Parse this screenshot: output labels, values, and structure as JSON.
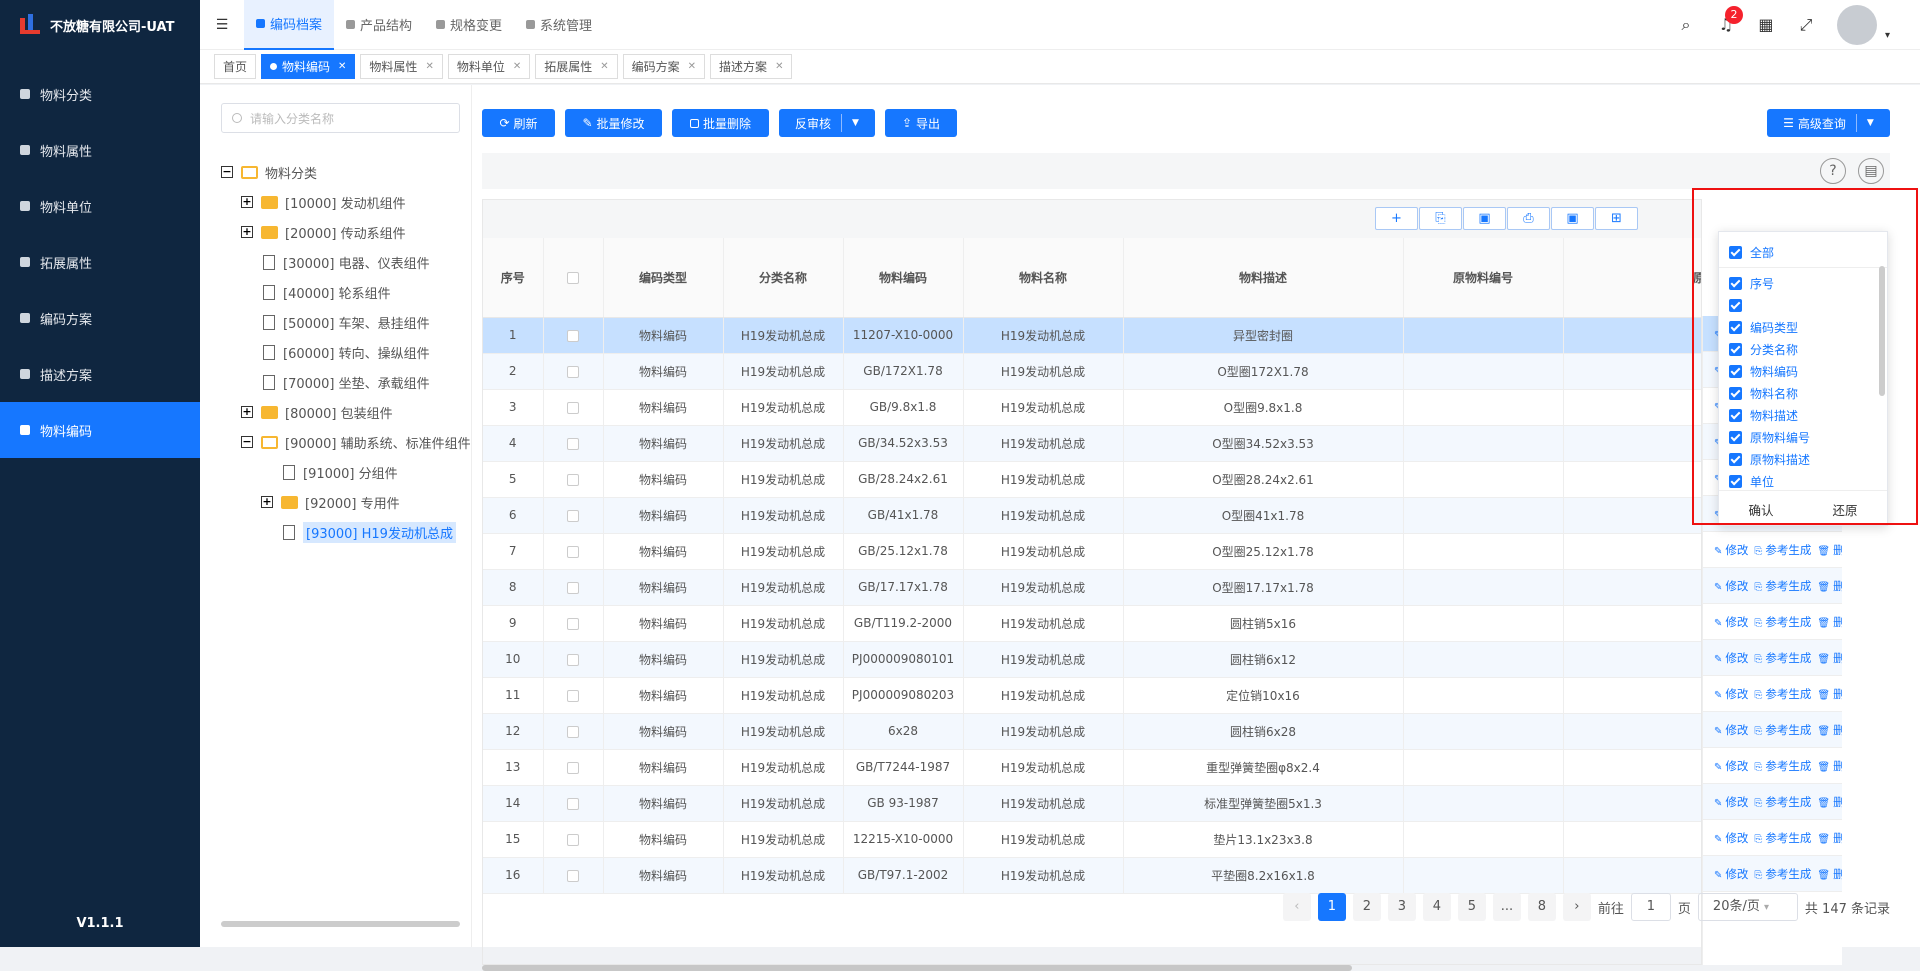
{
  "app": {
    "title": "不放糖有限公司-UAT",
    "version": "V1.1.1"
  },
  "sidebar": {
    "items": [
      {
        "label": "物料分类"
      },
      {
        "label": "物料属性"
      },
      {
        "label": "物料单位"
      },
      {
        "label": "拓展属性"
      },
      {
        "label": "编码方案"
      },
      {
        "label": "描述方案"
      },
      {
        "label": "物料编码"
      }
    ]
  },
  "header": {
    "tabs": [
      {
        "label": "编码档案"
      },
      {
        "label": "产品结构"
      },
      {
        "label": "规格变更"
      },
      {
        "label": "系统管理"
      }
    ],
    "notification_count": "2"
  },
  "tags": [
    {
      "label": "首页"
    },
    {
      "label": "物料编码"
    },
    {
      "label": "物料属性"
    },
    {
      "label": "物料单位"
    },
    {
      "label": "拓展属性"
    },
    {
      "label": "编码方案"
    },
    {
      "label": "描述方案"
    }
  ],
  "tree": {
    "search_placeholder": "请输入分类名称",
    "root": "物料分类",
    "nodes": [
      {
        "label": "[10000] 发动机组件"
      },
      {
        "label": "[20000] 传动系组件"
      },
      {
        "label": "[30000] 电器、仪表组件"
      },
      {
        "label": "[40000] 轮系组件"
      },
      {
        "label": "[50000] 车架、悬挂组件"
      },
      {
        "label": "[60000] 转向、操纵组件"
      },
      {
        "label": "[70000] 坐垫、承载组件"
      },
      {
        "label": "[80000] 包装组件"
      },
      {
        "label": "[90000] 辅助系统、标准件组件"
      },
      {
        "label": "[91000] 分组件"
      },
      {
        "label": "[92000] 专用件"
      },
      {
        "label": "[93000] H19发动机总成"
      }
    ]
  },
  "toolbar": {
    "refresh": "刷新",
    "batch_edit": "批量修改",
    "batch_delete": "批量删除",
    "unaudit": "反审核",
    "export": "导出",
    "advanced_search": "高级查询"
  },
  "table": {
    "columns": [
      "序号",
      "",
      "编码类型",
      "分类名称",
      "物料编码",
      "物料名称",
      "物料描述",
      "原物料编号",
      "原物料描述"
    ],
    "actions": {
      "edit": "修改",
      "ref": "参考生成",
      "del": "删除"
    },
    "rows": [
      {
        "no": "1",
        "type": "物料编码",
        "cat": "H19发动机总成",
        "code": "11207-X10-0000",
        "name": "H19发动机总成",
        "desc": "异型密封圈"
      },
      {
        "no": "2",
        "type": "物料编码",
        "cat": "H19发动机总成",
        "code": "GB/172X1.78",
        "name": "H19发动机总成",
        "desc": "O型圈172X1.78"
      },
      {
        "no": "3",
        "type": "物料编码",
        "cat": "H19发动机总成",
        "code": "GB/9.8x1.8",
        "name": "H19发动机总成",
        "desc": "O型圈9.8x1.8"
      },
      {
        "no": "4",
        "type": "物料编码",
        "cat": "H19发动机总成",
        "code": "GB/34.52x3.53",
        "name": "H19发动机总成",
        "desc": "O型圈34.52x3.53"
      },
      {
        "no": "5",
        "type": "物料编码",
        "cat": "H19发动机总成",
        "code": "GB/28.24x2.61",
        "name": "H19发动机总成",
        "desc": "O型圈28.24x2.61"
      },
      {
        "no": "6",
        "type": "物料编码",
        "cat": "H19发动机总成",
        "code": "GB/41x1.78",
        "name": "H19发动机总成",
        "desc": "O型圈41x1.78"
      },
      {
        "no": "7",
        "type": "物料编码",
        "cat": "H19发动机总成",
        "code": "GB/25.12x1.78",
        "name": "H19发动机总成",
        "desc": "O型圈25.12x1.78"
      },
      {
        "no": "8",
        "type": "物料编码",
        "cat": "H19发动机总成",
        "code": "GB/17.17x1.78",
        "name": "H19发动机总成",
        "desc": "O型圈17.17x1.78"
      },
      {
        "no": "9",
        "type": "物料编码",
        "cat": "H19发动机总成",
        "code": "GB/T119.2-2000",
        "name": "H19发动机总成",
        "desc": "圆柱销5x16"
      },
      {
        "no": "10",
        "type": "物料编码",
        "cat": "H19发动机总成",
        "code": "PJ000009080101",
        "name": "H19发动机总成",
        "desc": "圆柱销6x12"
      },
      {
        "no": "11",
        "type": "物料编码",
        "cat": "H19发动机总成",
        "code": "PJ000009080203",
        "name": "H19发动机总成",
        "desc": "定位销10x16"
      },
      {
        "no": "12",
        "type": "物料编码",
        "cat": "H19发动机总成",
        "code": "6x28",
        "name": "H19发动机总成",
        "desc": "圆柱销6x28"
      },
      {
        "no": "13",
        "type": "物料编码",
        "cat": "H19发动机总成",
        "code": "GB/T7244-1987",
        "name": "H19发动机总成",
        "desc": "重型弹簧垫圈φ8x2.4"
      },
      {
        "no": "14",
        "type": "物料编码",
        "cat": "H19发动机总成",
        "code": "GB 93-1987",
        "name": "H19发动机总成",
        "desc": "标准型弹簧垫圈5x1.3"
      },
      {
        "no": "15",
        "type": "物料编码",
        "cat": "H19发动机总成",
        "code": "12215-X10-0000",
        "name": "H19发动机总成",
        "desc": "垫片13.1x23x3.8"
      },
      {
        "no": "16",
        "type": "物料编码",
        "cat": "H19发动机总成",
        "code": "GB/T97.1-2002",
        "name": "H19发动机总成",
        "desc": "平垫圈8.2x16x1.8"
      }
    ]
  },
  "pagination": {
    "pages": [
      "1",
      "2",
      "3",
      "4",
      "5",
      "...",
      "8"
    ],
    "goto_prefix": "前往",
    "goto_value": "1",
    "goto_suffix": "页",
    "page_size": "20条/页",
    "total": "共 147 条记录"
  },
  "column_popup": {
    "all": "全部",
    "items": [
      "序号",
      "",
      "编码类型",
      "分类名称",
      "物料编码",
      "物料名称",
      "物料描述",
      "原物料编号",
      "原物料描述",
      "单位"
    ],
    "confirm": "确认",
    "reset": "还原"
  },
  "colors": {
    "primary": "#1677ff",
    "sidebar_bg": "#0f2640",
    "highlight_border": "#e11111"
  }
}
